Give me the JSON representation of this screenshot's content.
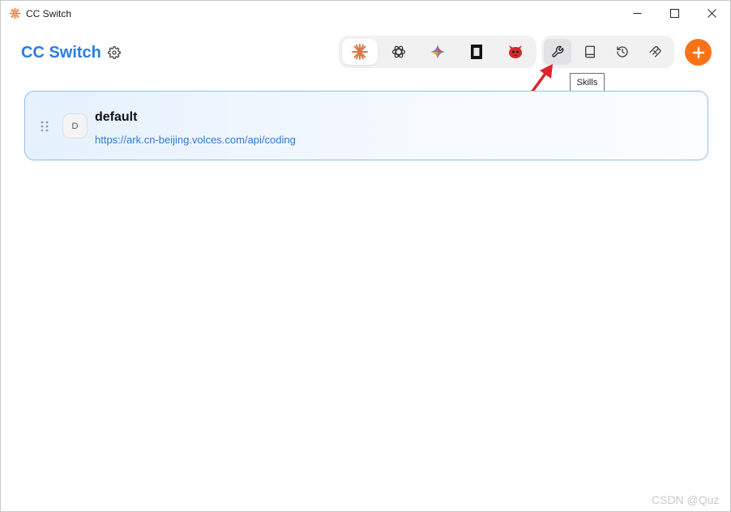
{
  "window": {
    "title": "CC Switch",
    "controls": [
      "minimize-icon",
      "maximize-icon",
      "close-icon"
    ]
  },
  "header": {
    "brand": "CC Switch",
    "settings_icon": "gear-icon",
    "apps": [
      {
        "icon": "claude-icon",
        "active": true
      },
      {
        "icon": "openai-icon",
        "active": false
      },
      {
        "icon": "gemini-icon",
        "active": false
      },
      {
        "icon": "opencode-icon",
        "active": false
      },
      {
        "icon": "red-bird-icon",
        "active": false
      }
    ],
    "tools": [
      {
        "icon": "wrench-icon",
        "tooltip": "Skills"
      },
      {
        "icon": "book-icon"
      },
      {
        "icon": "history-icon"
      },
      {
        "icon": "plug-icon"
      }
    ],
    "add_icon": "plus-icon",
    "accent_color": "#f97316",
    "brand_color": "#2a7de1"
  },
  "tooltip": {
    "text": "Skills"
  },
  "providers": [
    {
      "avatar_letter": "D",
      "name": "default",
      "url": "https://ark.cn-beijing.volces.com/api/coding"
    }
  ],
  "watermark": "CSDN @Quz"
}
